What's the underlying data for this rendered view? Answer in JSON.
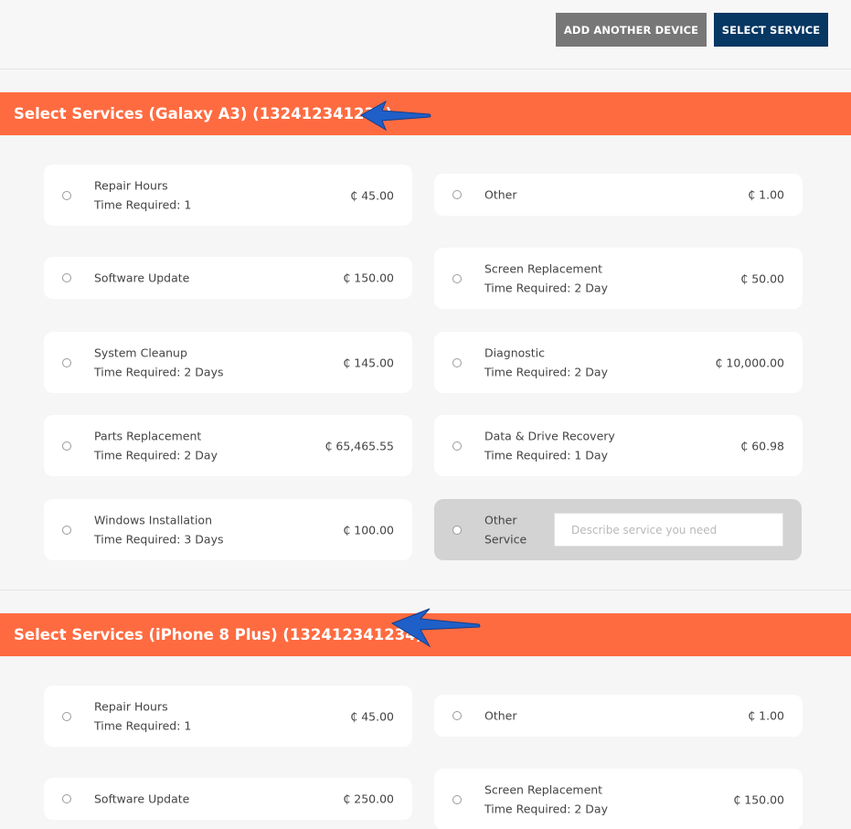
{
  "toolbar": {
    "add_device_label": "ADD ANOTHER DEVICE",
    "select_service_label": "SELECT SERVICE"
  },
  "currency_symbol": "₵",
  "colors": {
    "header_accent": "#ff6b40",
    "primary_button": "#073763",
    "secondary_button": "#777777",
    "annotation_arrow": "#1f5fc8"
  },
  "sections": [
    {
      "title": "Select Services (Galaxy A3) (132412341234)",
      "services": [
        {
          "name": "Repair Hours",
          "time": "Time Required: 1",
          "price": "₵ 45.00"
        },
        {
          "name": "Other",
          "time": "",
          "price": "₵ 1.00"
        },
        {
          "name": "Software Update",
          "time": "",
          "price": "₵ 150.00"
        },
        {
          "name": "Screen Replacement",
          "time": "Time Required: 2 Day",
          "price": "₵ 50.00"
        },
        {
          "name": "System Cleanup",
          "time": "Time Required: 2 Days",
          "price": "₵ 145.00"
        },
        {
          "name": "Diagnostic",
          "time": "Time Required: 2 Day",
          "price": "₵ 10,000.00"
        },
        {
          "name": "Parts Replacement",
          "time": "Time Required: 2 Day",
          "price": "₵ 65,465.55"
        },
        {
          "name": "Data & Drive Recovery",
          "time": "Time Required: 1 Day",
          "price": "₵ 60.98"
        },
        {
          "name": "Windows Installation",
          "time": "Time Required: 3 Days",
          "price": "₵ 100.00"
        }
      ],
      "other_service": {
        "label_line1": "Other",
        "label_line2": "Service",
        "placeholder": "Describe service you need"
      }
    },
    {
      "title": "Select Services (iPhone 8 Plus) (132412341234)",
      "services": [
        {
          "name": "Repair Hours",
          "time": "Time Required: 1",
          "price": "₵ 45.00"
        },
        {
          "name": "Other",
          "time": "",
          "price": "₵ 1.00"
        },
        {
          "name": "Software Update",
          "time": "",
          "price": "₵ 250.00"
        },
        {
          "name": "Screen Replacement",
          "time": "Time Required: 2 Day",
          "price": "₵ 150.00"
        }
      ]
    }
  ]
}
